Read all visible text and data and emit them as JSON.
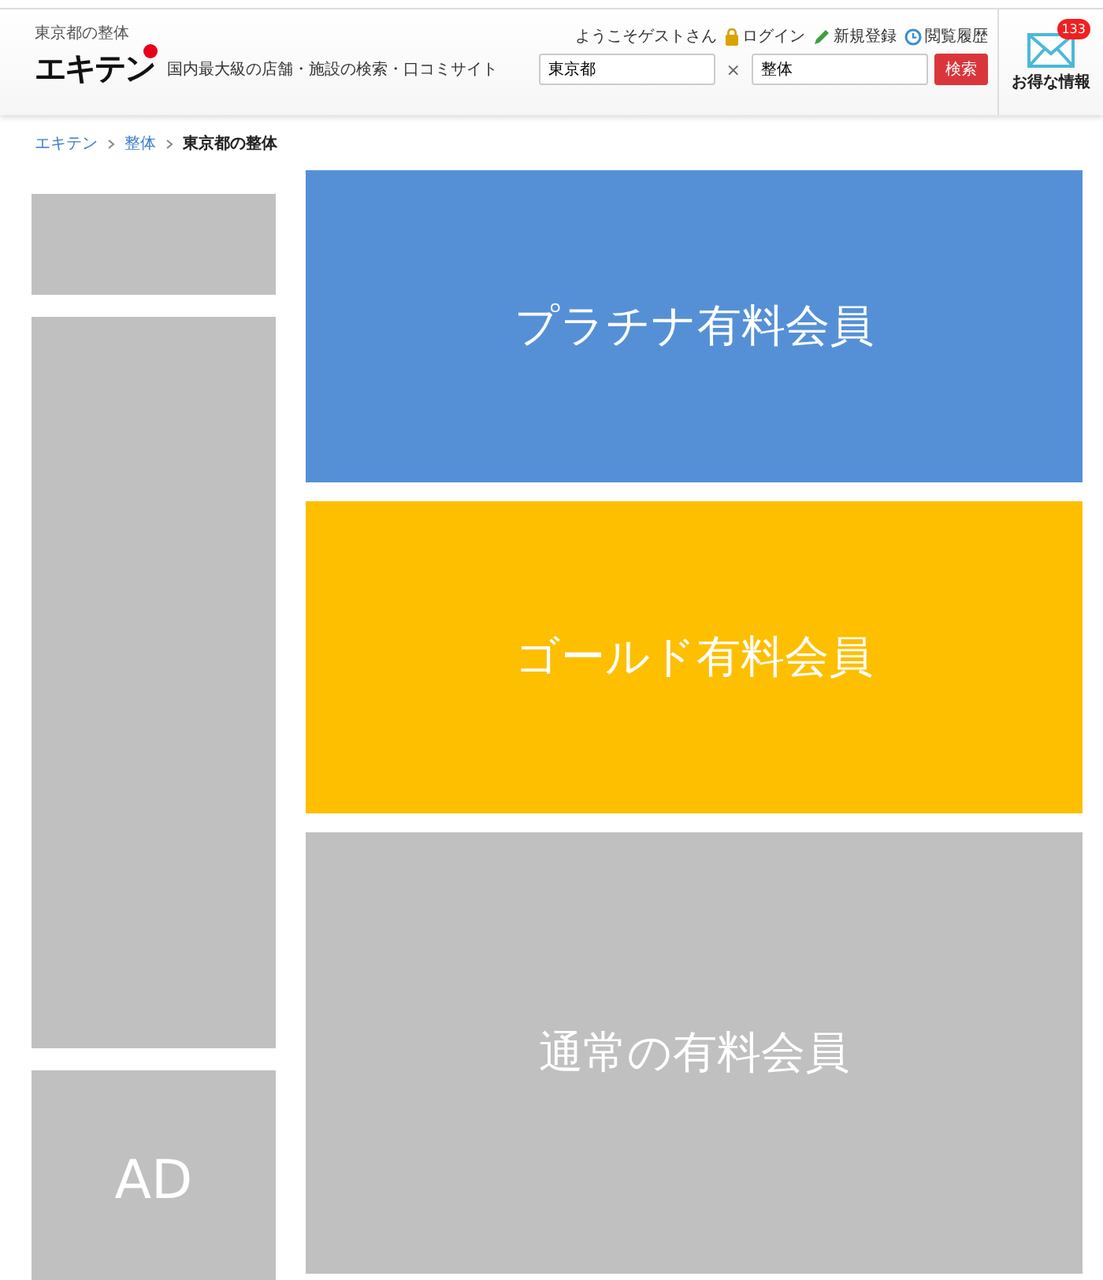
{
  "header": {
    "area_label": "東京都の整体",
    "logo": "エキテン",
    "tagline": "国内最大級の店舗・施設の検索・口コミサイト",
    "welcome": "ようこそゲストさん",
    "links": [
      {
        "kind": "lock",
        "label": "ログイン"
      },
      {
        "kind": "pencil",
        "label": "新規登録"
      },
      {
        "kind": "clock",
        "label": "閲覧履歴"
      }
    ],
    "search": {
      "area": "東京都",
      "separator": "×",
      "keyword": "整体",
      "button": "検索"
    },
    "mail": {
      "badge": "133",
      "label": "お得な情報"
    }
  },
  "breadcrumb": [
    {
      "label": "エキテン",
      "link": true
    },
    {
      "label": "整体",
      "link": true
    },
    {
      "label": "東京都の整体",
      "link": false
    }
  ],
  "sidebar": [
    {
      "kind": "small"
    },
    {
      "kind": "tall"
    },
    {
      "kind": "ad",
      "label": "AD"
    }
  ],
  "listings": [
    {
      "label": "プラチナ有料会員",
      "color": "#5590d6"
    },
    {
      "label": "ゴールド有料会員",
      "color": "#fdbf00"
    },
    {
      "label": "通常の有料会員",
      "color": "#c0c0c0"
    }
  ]
}
